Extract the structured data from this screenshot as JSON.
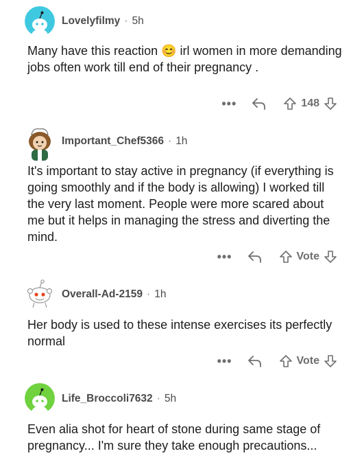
{
  "comments": [
    {
      "username": "Lovelyfilmy",
      "age": "5h",
      "text_before_emoji": "Many have this reaction ",
      "emoji": "😊",
      "text_after_emoji": " irl women in more demanding jobs often work till end of their pregnancy .",
      "vote_label": "148",
      "avatar_color": "#3fc9e0"
    },
    {
      "username": "Important_Chef5366",
      "age": "1h",
      "text": "It's important to stay active in pregnancy (if everything is going smoothly and if the body is allowing) I worked till the very last moment. People were more scared about me but it helps in managing the stress and diverting the mind.",
      "vote_label": "Vote",
      "avatar_color": "#8a5a2b"
    },
    {
      "username": "Overall-Ad-2159",
      "age": "1h",
      "text": "Her body is used to these intense exercises its perfectly normal",
      "vote_label": "Vote",
      "avatar_color": "#ffffff"
    },
    {
      "username": "Life_Broccoli7632",
      "age": "5h",
      "text": "Even alia shot for heart of stone during same stage of pregnancy... I'm sure they take enough precautions...",
      "avatar_color": "#6fd23e"
    }
  ],
  "separator": "·",
  "more_glyph": "•••",
  "icons": [
    "more-icon",
    "reply-icon",
    "upvote-icon",
    "downvote-icon"
  ],
  "colors": {
    "text": "#1c1c1c",
    "meta": "#4a4a4c",
    "action": "#6e6e70"
  }
}
